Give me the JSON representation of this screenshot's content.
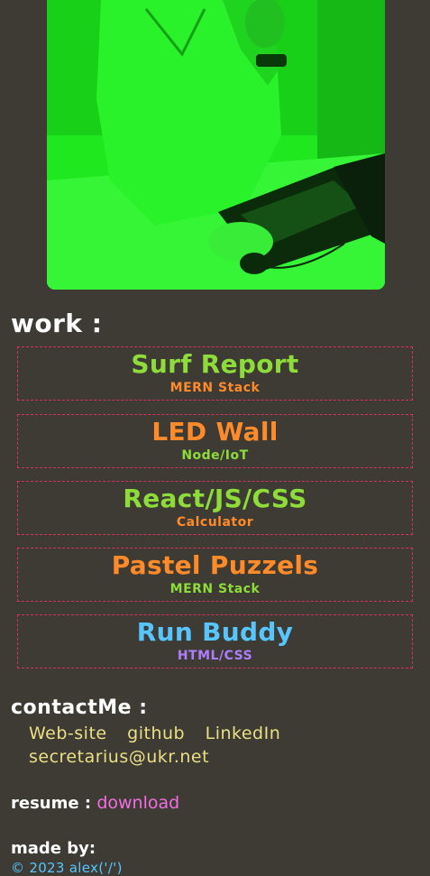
{
  "profile_photo": {
    "alt": "portrait photo with green tint",
    "tint_color": "#1fe81f"
  },
  "work": {
    "heading": "work :",
    "projects": [
      {
        "title": "Surf Report",
        "subtitle": "MERN Stack",
        "title_color": "#8ddc3a",
        "subtitle_color": "#ff8a2a"
      },
      {
        "title": "LED Wall",
        "subtitle": "Node/IoT",
        "title_color": "#ff8a2a",
        "subtitle_color": "#8ddc3a"
      },
      {
        "title": "React/JS/CSS",
        "subtitle": "Calculator",
        "title_color": "#8ddc3a",
        "subtitle_color": "#ff8a2a"
      },
      {
        "title": "Pastel Puzzels",
        "subtitle": "MERN Stack",
        "title_color": "#ff8a2a",
        "subtitle_color": "#8ddc3a"
      },
      {
        "title": "Run Buddy",
        "subtitle": "HTML/CSS",
        "title_color": "#57c6ff",
        "subtitle_color": "#b07dff"
      }
    ]
  },
  "contact": {
    "heading": "contactMe :",
    "links": [
      "Web-site",
      "github",
      "LinkedIn"
    ],
    "email": "secretarius@ukr.net"
  },
  "resume": {
    "label": "resume :",
    "link_text": "download"
  },
  "footer": {
    "made_by": "made by:",
    "copyright": "© 2023 alex('/')"
  },
  "colors": {
    "background": "#3d3b34",
    "border_dashed": "#d8325b",
    "link_yellow": "#ecdf86",
    "download_pink": "#f26ee2",
    "copyright_blue": "#57c6ff"
  }
}
